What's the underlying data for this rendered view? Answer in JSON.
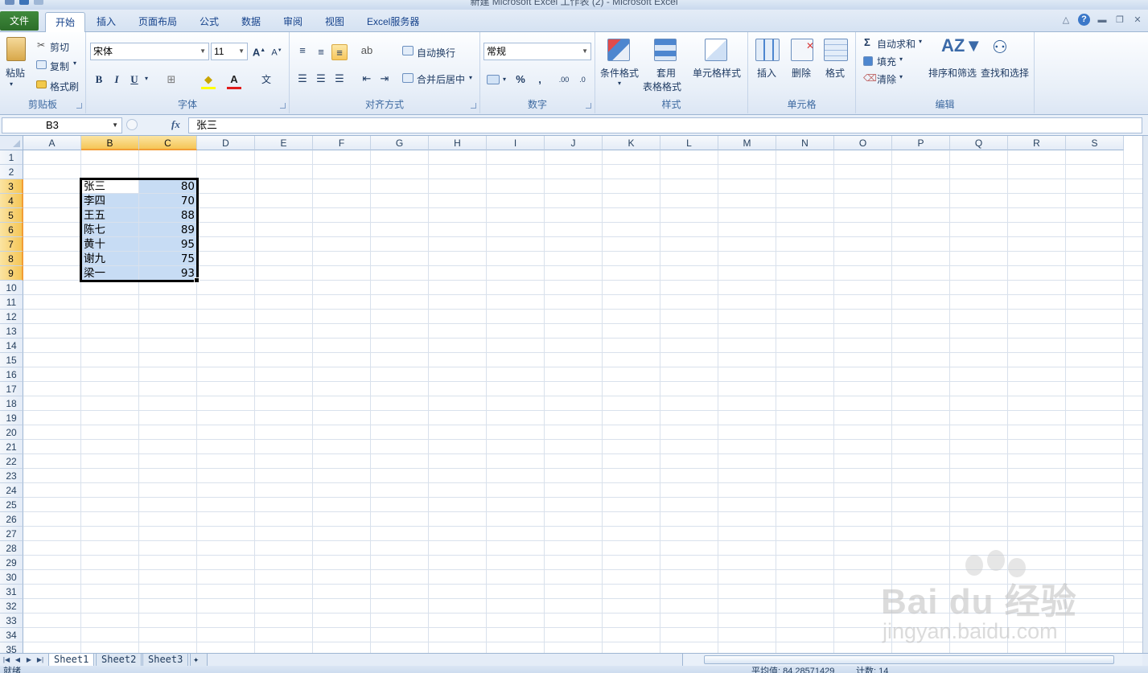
{
  "window": {
    "title": "新建 Microsoft Excel 工作表 (2) - Microsoft Excel"
  },
  "tabs": [
    {
      "label": "文件"
    },
    {
      "label": "开始"
    },
    {
      "label": "插入"
    },
    {
      "label": "页面布局"
    },
    {
      "label": "公式"
    },
    {
      "label": "数据"
    },
    {
      "label": "审阅"
    },
    {
      "label": "视图"
    },
    {
      "label": "Excel服务器"
    }
  ],
  "ribbon": {
    "clipboard": {
      "label": "剪贴板",
      "paste": "粘贴",
      "cut": "剪切",
      "copy": "复制",
      "format_painter": "格式刷"
    },
    "font": {
      "label": "字体",
      "name": "宋体",
      "size": "11"
    },
    "alignment": {
      "label": "对齐方式",
      "wrap": "自动换行",
      "merge": "合并后居中"
    },
    "number": {
      "label": "数字",
      "format": "常规",
      "percent": "%",
      "comma": ","
    },
    "styles": {
      "label": "样式",
      "conditional": "条件格式",
      "table1": "套用",
      "table2": "表格格式",
      "cell_styles": "单元格样式"
    },
    "cells": {
      "label": "单元格",
      "insert": "插入",
      "delete": "删除",
      "format": "格式"
    },
    "editing": {
      "label": "编辑",
      "autosum": "自动求和",
      "fill": "填充",
      "clear": "清除",
      "sort": "排序和筛选",
      "find": "查找和选择"
    }
  },
  "formula_bar": {
    "name_box": "B3",
    "fx": "fx",
    "content": "张三"
  },
  "columns": [
    "A",
    "B",
    "C",
    "D",
    "E",
    "F",
    "G",
    "H",
    "I",
    "J",
    "K",
    "L",
    "M",
    "N",
    "O",
    "P",
    "Q",
    "R",
    "S"
  ],
  "rows": [
    "1",
    "2",
    "3",
    "4",
    "5",
    "6",
    "7",
    "8",
    "9",
    "10",
    "11",
    "12",
    "13",
    "14",
    "15",
    "16",
    "17",
    "18",
    "19",
    "20",
    "21",
    "22",
    "23",
    "24",
    "25",
    "26",
    "27",
    "28",
    "29",
    "30",
    "31",
    "32",
    "33",
    "34",
    "35"
  ],
  "selection": {
    "range": "B3:C9",
    "active_cell": "B3",
    "highlight_color": "#c7dcf4"
  },
  "cells": [
    {
      "name": "张三",
      "score": "80"
    },
    {
      "name": "李四",
      "score": "70"
    },
    {
      "name": "王五",
      "score": "88"
    },
    {
      "name": "陈七",
      "score": "89"
    },
    {
      "name": "黄十",
      "score": "95"
    },
    {
      "name": "谢九",
      "score": "75"
    },
    {
      "name": "梁一",
      "score": "93"
    }
  ],
  "sheets": [
    "Sheet1",
    "Sheet2",
    "Sheet3"
  ],
  "status": {
    "ready": "就绪",
    "average": "平均值: 84.28571429",
    "count": "计数: 14"
  },
  "watermark": {
    "brand": "Bai du 经验",
    "url": "jingyan.baidu.com"
  }
}
